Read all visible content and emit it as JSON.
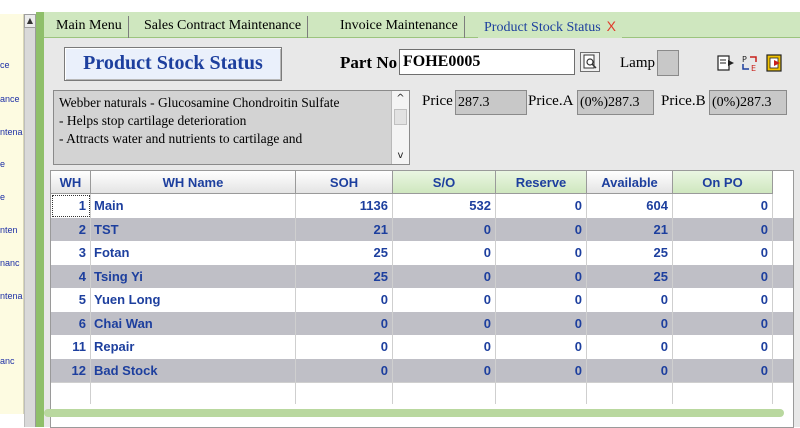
{
  "sidebar": {
    "items": [
      "ce",
      "ance",
      "ntena",
      "e",
      "e",
      "nten",
      "nanc",
      "ntena",
      "anc"
    ]
  },
  "tabs": [
    {
      "label": "Main Menu"
    },
    {
      "label": "Sales Contract Maintenance"
    },
    {
      "label": "Invoice Maintenance"
    },
    {
      "label": "Product Stock Status",
      "active": true,
      "close": "X"
    }
  ],
  "header": {
    "title": "Product Stock Status",
    "part_no_label": "Part No",
    "part_no_value": "FOHE0005",
    "lamp_label": "Lamp",
    "icons": [
      "magnifier-icon",
      "export-icon",
      "transfer-icon",
      "exit-icon"
    ]
  },
  "description": {
    "lines": [
      "Webber naturals - Glucosamine Chondroitin Sulfate",
      "- Helps stop cartilage deterioration",
      "- Attracts water and nutrients to cartilage and"
    ]
  },
  "prices": {
    "price_label": "Price",
    "price_value": "287.3",
    "price_a_label": "Price.A",
    "price_a_value": "(0%)287.3",
    "price_b_label": "Price.B",
    "price_b_value": "(0%)287.3"
  },
  "grid": {
    "columns": [
      "WH",
      "WH Name",
      "SOH",
      "S/O",
      "Reserve",
      "Available",
      "On PO"
    ],
    "rows": [
      {
        "wh": "1",
        "name": "Main",
        "soh": "1136",
        "so": "532",
        "reserve": "0",
        "available": "604",
        "onpo": "0"
      },
      {
        "wh": "2",
        "name": "TST",
        "soh": "21",
        "so": "0",
        "reserve": "0",
        "available": "21",
        "onpo": "0"
      },
      {
        "wh": "3",
        "name": "Fotan",
        "soh": "25",
        "so": "0",
        "reserve": "0",
        "available": "25",
        "onpo": "0"
      },
      {
        "wh": "4",
        "name": "Tsing Yi",
        "soh": "25",
        "so": "0",
        "reserve": "0",
        "available": "25",
        "onpo": "0"
      },
      {
        "wh": "5",
        "name": "Yuen Long",
        "soh": "0",
        "so": "0",
        "reserve": "0",
        "available": "0",
        "onpo": "0"
      },
      {
        "wh": "6",
        "name": "Chai Wan",
        "soh": "0",
        "so": "0",
        "reserve": "0",
        "available": "0",
        "onpo": "0"
      },
      {
        "wh": "11",
        "name": "Repair",
        "soh": "0",
        "so": "0",
        "reserve": "0",
        "available": "0",
        "onpo": "0"
      },
      {
        "wh": "12",
        "name": "Bad Stock",
        "soh": "0",
        "so": "0",
        "reserve": "0",
        "available": "0",
        "onpo": "0"
      }
    ]
  },
  "colors": {
    "accent_blue": "#1d3f9e",
    "tab_green": "#cfe7bf",
    "close_red": "#e03a2a",
    "row_alt": "#bfbfc6"
  }
}
